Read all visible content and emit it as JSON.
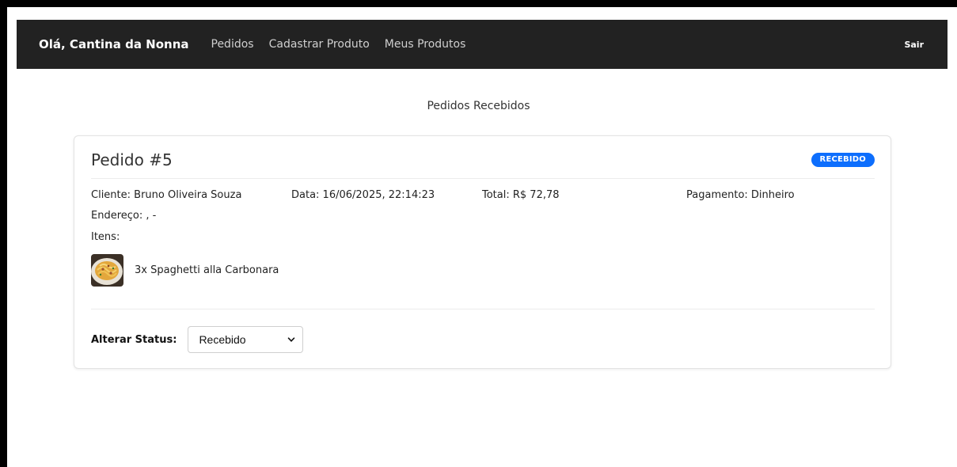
{
  "navbar": {
    "brand": "Olá, Cantina da Nonna",
    "links": [
      "Pedidos",
      "Cadastrar Produto",
      "Meus Produtos"
    ],
    "logout": "Sair"
  },
  "page": {
    "heading": "Pedidos Recebidos"
  },
  "order": {
    "title": "Pedido #5",
    "status_badge": "RECEBIDO",
    "client": "Cliente: Bruno Oliveira Souza",
    "date": "Data: 16/06/2025, 22:14:23",
    "total": "Total: R$ 72,78",
    "payment": "Pagamento: Dinheiro",
    "address": "Endereço: , -",
    "items_label": "Itens:",
    "items": [
      {
        "text": "3x Spaghetti alla Carbonara",
        "thumbnail": "pasta-dish-image"
      }
    ],
    "status_label": "Alterar Status:",
    "status_selected": "Recebido"
  },
  "colors": {
    "navbar_bg": "#222222",
    "badge_bg": "#0d6efd"
  }
}
